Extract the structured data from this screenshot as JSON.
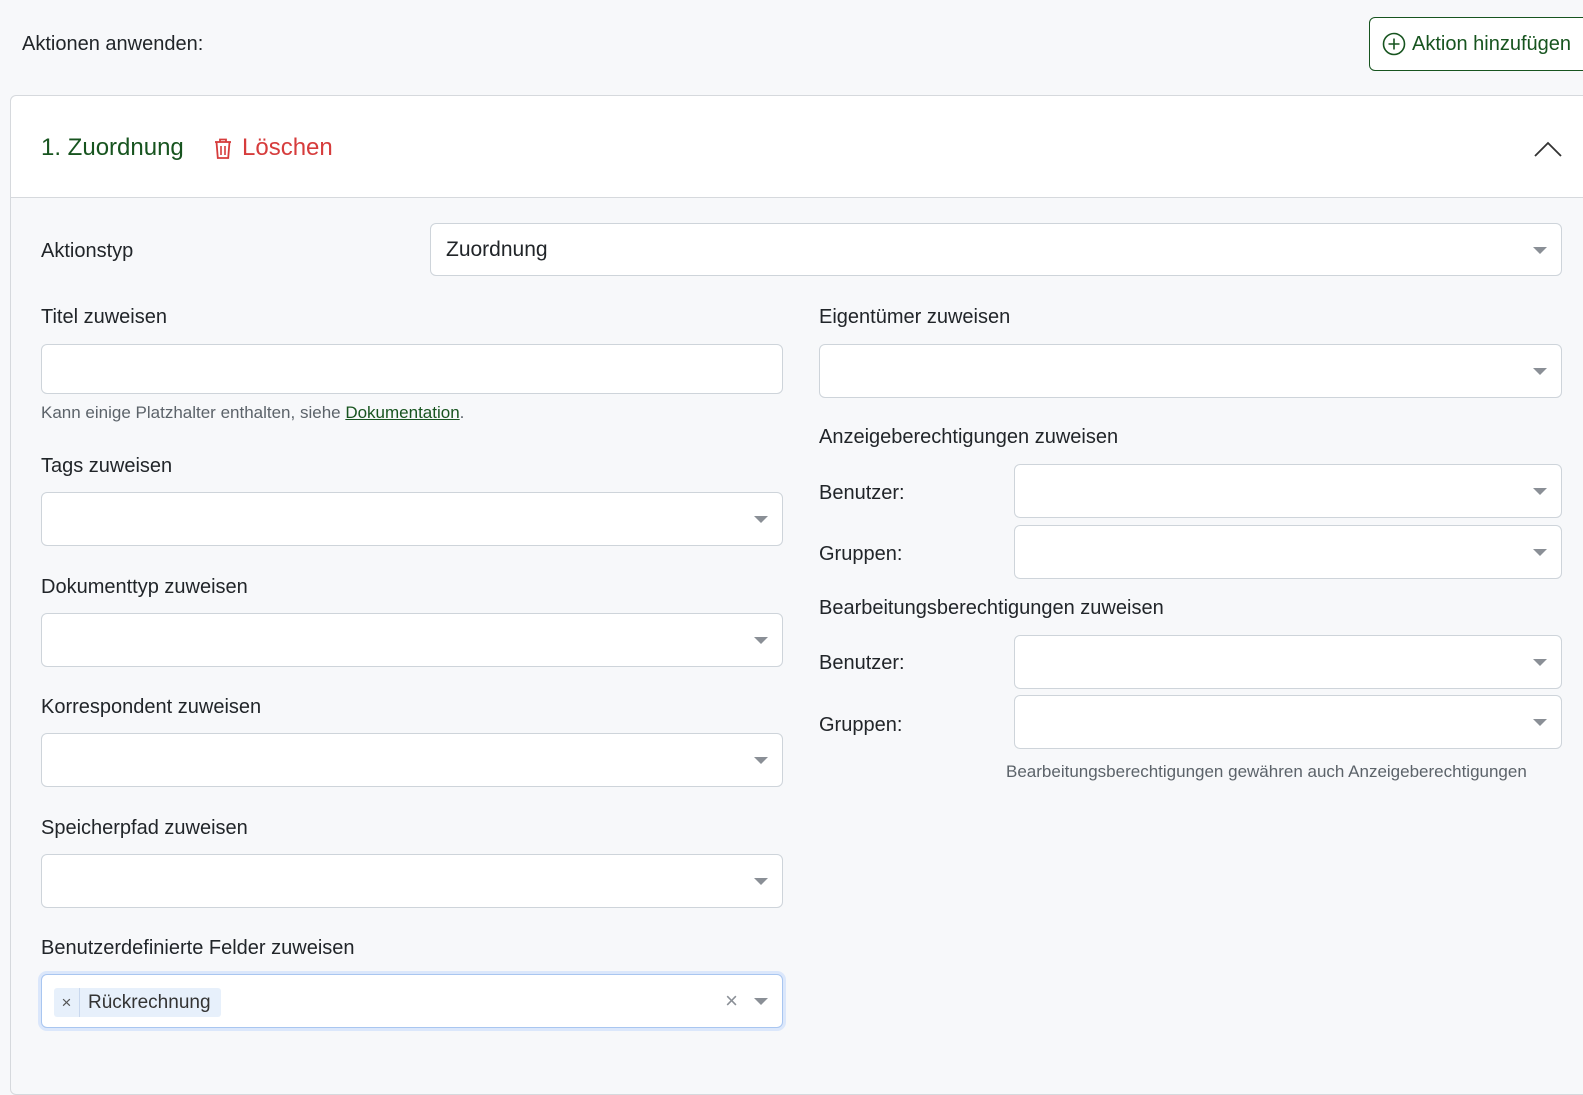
{
  "header": {
    "apply_label": "Aktionen anwenden:",
    "add_button": "Aktion hinzufügen"
  },
  "action": {
    "title": "1. Zuordnung",
    "delete_label": "Löschen",
    "type_label": "Aktionstyp",
    "type_value": "Zuordnung"
  },
  "left": {
    "title_label": "Titel zuweisen",
    "title_value": "",
    "title_hint_prefix": "Kann einige Platzhalter enthalten, siehe ",
    "title_hint_link": "Dokumentation",
    "title_hint_suffix": ".",
    "tags_label": "Tags zuweisen",
    "doctype_label": "Dokumenttyp zuweisen",
    "correspondent_label": "Korrespondent zuweisen",
    "storagepath_label": "Speicherpfad zuweisen",
    "customfields_label": "Benutzerdefinierte Felder zuweisen",
    "customfields_selected": "Rückrechnung"
  },
  "right": {
    "owner_label": "Eigentümer zuweisen",
    "view_perm_label": "Anzeigeberechtigungen zuweisen",
    "edit_perm_label": "Bearbeitungsberechtigungen zuweisen",
    "users_label": "Benutzer:",
    "groups_label": "Gruppen:",
    "edit_hint": "Bearbeitungsberechtigungen gewähren auch Anzeigeberechtigungen"
  },
  "colors": {
    "accent": "#17541f",
    "danger": "#d63c3c"
  }
}
